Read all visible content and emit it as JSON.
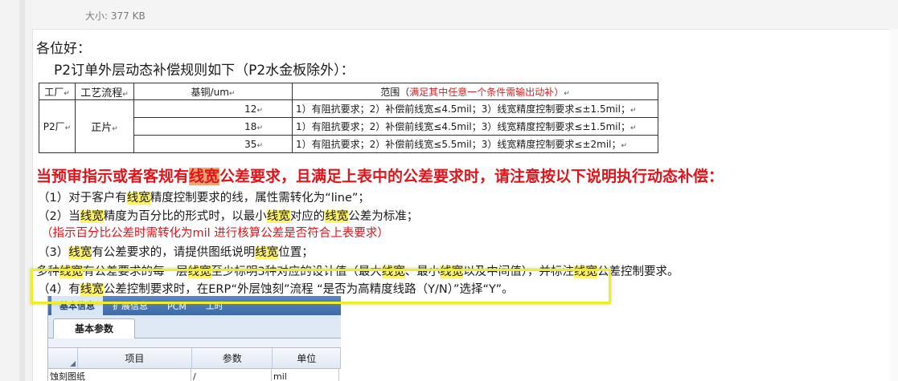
{
  "header": {
    "file_size": "大小: 377 KB"
  },
  "greeting": "各位好：",
  "intro": "P2订单外层动态补偿规则如下（P2水金板除外）：",
  "table": {
    "headers": {
      "factory": "工厂",
      "process": "工艺流程",
      "copper": "基铜/um",
      "range_prefix": "范围（",
      "range_note": "满足其中任意一个条件需输出动补）"
    },
    "factory": "P2厂",
    "process": "正片",
    "rows": [
      {
        "copper": "12",
        "range": "1）有阻抗要求；2）补偿前线宽≤4.5mil；3）线宽精度控制要求≤±1.5mil；"
      },
      {
        "copper": "18",
        "range": "1）有阻抗要求；2）补偿前线宽≤4.5mil；3）线宽精度控制要求≤±1.5mil；"
      },
      {
        "copper": "35",
        "range": "1）有阻抗要求；2）补偿前线宽≤5.5mil；3）线宽精度控制要求≤±2mil；"
      }
    ]
  },
  "warning": {
    "before": "当预审指示或者客规有",
    "highlight": "线宽",
    "after": "公差要求，且满足上表中的公差要求时，请注意按以下说明执行动态补偿："
  },
  "lines": {
    "l1": {
      "a": "（1）对于客户有",
      "b": "线宽",
      "c": "精度控制要求的线，属性需转化为“line”；"
    },
    "l2": {
      "a": "（2）当",
      "b": "线宽",
      "c": "精度为百分比的形式时，以最小",
      "d": "线宽",
      "e": "对应的",
      "f": "线宽",
      "g": "公差为标准；"
    },
    "l3": "（指示百分比公差时需转化为mil 进行核算公差是否符合上表要求）",
    "l4": {
      "a": "（3）",
      "b": "线宽",
      "c": "有公差要求的，请提供图纸说明",
      "d": "线宽",
      "e": "位置；"
    },
    "l5": {
      "a": "多种",
      "b": "线宽",
      "c": "有公差要求的每一层",
      "d": "线宽",
      "e": "至少标明3种对应的设计值（最大",
      "f": "线宽",
      "g": "、最小",
      "h": "线宽",
      "i": "以及中间值），并标注",
      "j": "线宽",
      "k": "公差控制要求。"
    },
    "l6": {
      "a": "（4）有",
      "b": "线宽",
      "c": "公差控制要求时，在ERP“外层蚀刻”流程 “是否为高精度线路（Y/N）”选择“Y”。"
    }
  },
  "screenshot": {
    "tabs": [
      "基本信息",
      "扩展信息",
      "PCM",
      "工时"
    ],
    "subtab": "基本参数",
    "columns": [
      "项目",
      "参数",
      "单位"
    ],
    "row": [
      "蚀刻图纸",
      "/",
      "mil"
    ]
  },
  "colors": {
    "red": "#e0141a",
    "highlight": "#fff36a",
    "callout_border": "#eded2a"
  }
}
